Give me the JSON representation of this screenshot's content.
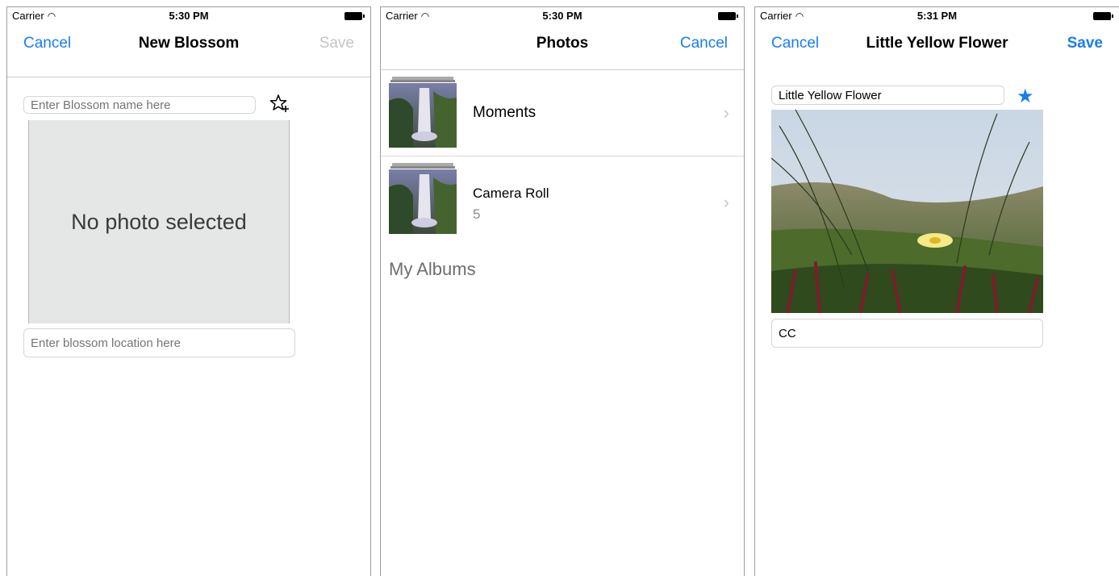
{
  "screens": [
    {
      "status": {
        "carrier": "Carrier",
        "time": "5:30 PM"
      },
      "nav": {
        "left": "Cancel",
        "title": "New Blossom",
        "right": "Save"
      },
      "name_placeholder": "Enter Blossom name here",
      "photo_placeholder": "No photo selected",
      "location_placeholder": "Enter blossom location here"
    },
    {
      "status": {
        "carrier": "Carrier",
        "time": "5:30 PM"
      },
      "nav": {
        "title": "Photos",
        "right": "Cancel"
      },
      "albums": [
        {
          "label": "Moments",
          "count": ""
        },
        {
          "label": "Camera Roll",
          "count": "5"
        }
      ],
      "section_title": "My Albums"
    },
    {
      "status": {
        "carrier": "Carrier",
        "time": "5:31 PM"
      },
      "nav": {
        "left": "Cancel",
        "title": "Little Yellow Flower",
        "right": "Save"
      },
      "name_value": "Little Yellow Flower",
      "location_value": "CC"
    }
  ],
  "icons": {
    "wifi": "wifi-icon",
    "battery": "battery-icon",
    "star_add": "star-add-icon",
    "star_filled": "star-filled-icon",
    "chevron": "chevron-right-icon"
  },
  "colors": {
    "accent": "#1a7cf5",
    "disabled": "#c4c4c4",
    "placeholder_bg": "#e5e6e6"
  }
}
